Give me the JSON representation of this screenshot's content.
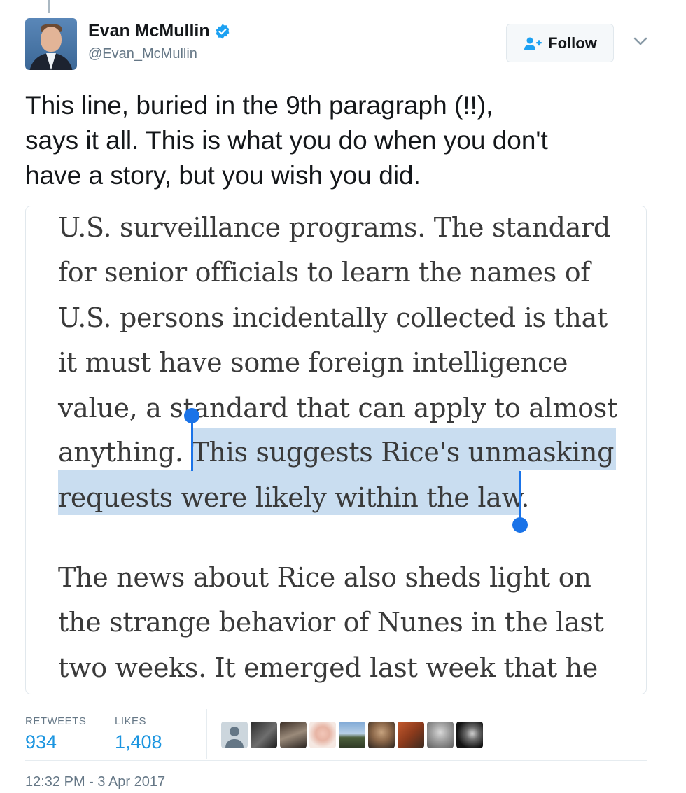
{
  "header": {
    "display_name": "Evan McMullin",
    "handle": "@Evan_McMullin",
    "follow_label": "Follow",
    "verified_icon": "verified-badge-icon",
    "follow_icon": "person-plus-icon",
    "more_icon": "chevron-down-icon"
  },
  "tweet": {
    "text": "This line, buried in the 9th paragraph (!!),\nsays it all. This is what you do when you don't\nhave a story, but you wish you did."
  },
  "article": {
    "lines": [
      "U.S. surveillance programs. The standard",
      "for senior officials to learn the names of",
      "U.S. persons incidentally collected is that",
      "it must have some foreign intelligence",
      "value, a standard that can apply to almost",
      "anything. This suggests Rice's unmasking",
      "requests were likely within the law.",
      "The news about Rice also sheds light on",
      "the strange behavior of Nunes in the last",
      "two weeks. It emerged last week that he"
    ],
    "highlighted_text": "This suggests Rice's unmasking requests were likely within the law."
  },
  "stats": {
    "retweets_label": "RETWEETS",
    "retweets_value": "934",
    "likes_label": "LIKES",
    "likes_value": "1,408"
  },
  "likers": [
    "default-avatar",
    "avatar-2",
    "avatar-3",
    "avatar-4",
    "avatar-5",
    "avatar-6",
    "avatar-7",
    "avatar-8",
    "avatar-9"
  ],
  "timestamp": "12:32 PM - 3 Apr 2017",
  "colors": {
    "accent": "#1b95e0",
    "selection": "#c9ddf0",
    "selection_handle": "#1a73e8",
    "verified": "#1da1f2"
  }
}
